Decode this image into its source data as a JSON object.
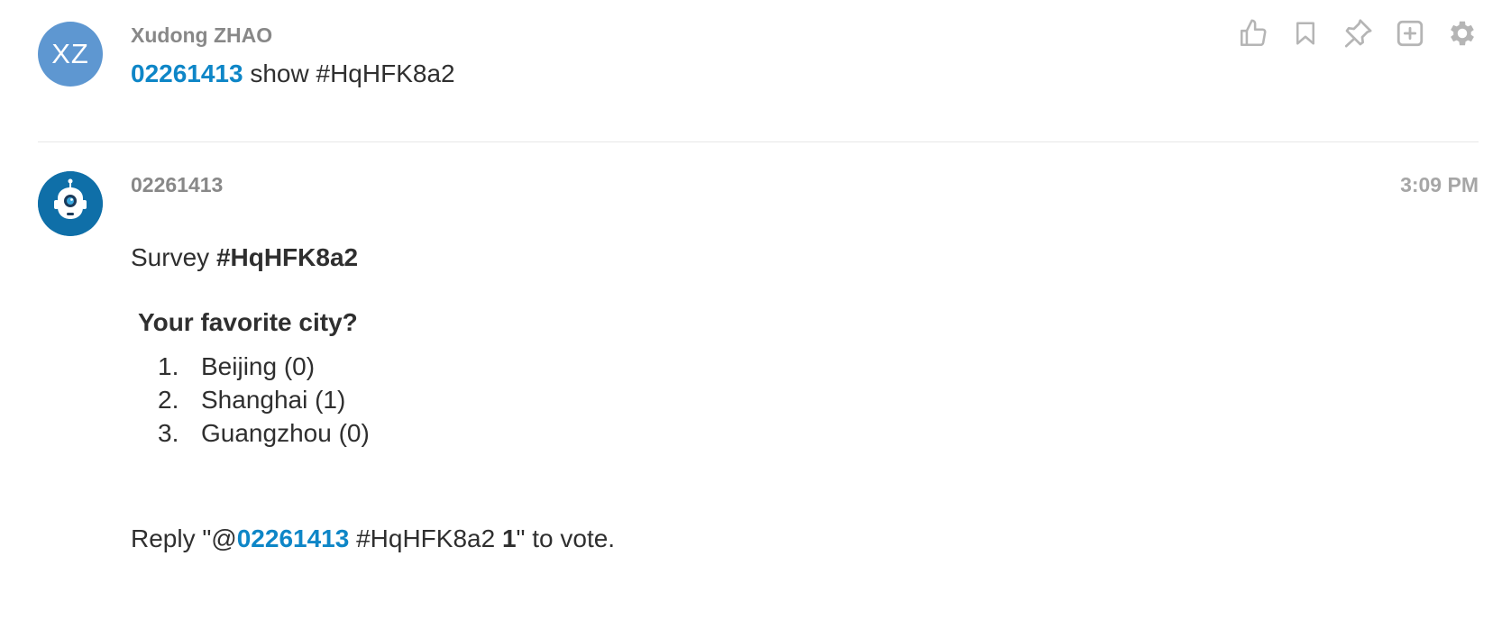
{
  "message1": {
    "avatar_initials": "XZ",
    "author": "Xudong ZHAO",
    "mention": "02261413",
    "text": " show #HqHFK8a2"
  },
  "toolbar": {
    "icons": [
      "thumbs-up-icon",
      "bookmark-icon",
      "pin-icon",
      "add-box-icon",
      "gear-icon"
    ]
  },
  "message2": {
    "author": "02261413",
    "timestamp": "3:09 PM",
    "survey_prefix": "Survey ",
    "survey_id": "#HqHFK8a2",
    "question": "Your favorite city?",
    "options": [
      {
        "num": "1.",
        "label": "Beijing (0)"
      },
      {
        "num": "2.",
        "label": "Shanghai (1)"
      },
      {
        "num": "3.",
        "label": "Guangzhou (0)"
      }
    ],
    "reply": {
      "prefix": "Reply \"@",
      "mention": "02261413",
      "middle": " #HqHFK8a2 ",
      "vote_number": "1",
      "suffix": "\" to vote."
    }
  },
  "colors": {
    "mention": "#0e86c7",
    "avatar_user": "#5e97d1",
    "avatar_bot": "#0f6fa8",
    "icon_gray": "#b5b5b5"
  }
}
